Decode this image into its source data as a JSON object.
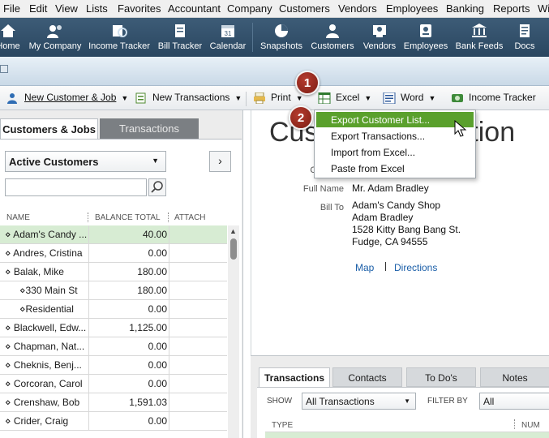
{
  "menubar": {
    "items": [
      "File",
      "Edit",
      "View",
      "Lists",
      "Favorites",
      "Accountant",
      "Company",
      "Customers",
      "Vendors",
      "Employees",
      "Banking",
      "Reports",
      "Wi"
    ]
  },
  "iconbar": {
    "items": [
      {
        "label": "Home",
        "icon": "home-icon"
      },
      {
        "label": "My Company",
        "icon": "my-company-icon"
      },
      {
        "label": "Income Tracker",
        "icon": "income-tracker-icon"
      },
      {
        "label": "Bill Tracker",
        "icon": "bill-tracker-icon"
      },
      {
        "label": "Calendar",
        "icon": "calendar-icon"
      },
      {
        "label": "Snapshots",
        "icon": "snapshots-icon"
      },
      {
        "label": "Customers",
        "icon": "customers-icon"
      },
      {
        "label": "Vendors",
        "icon": "vendors-icon"
      },
      {
        "label": "Employees",
        "icon": "employees-icon"
      },
      {
        "label": "Bank Feeds",
        "icon": "bank-feeds-icon"
      },
      {
        "label": "Docs",
        "icon": "docs-icon"
      }
    ],
    "calendar_day": "31"
  },
  "toolbar": {
    "new_customer_job": "New Customer & Job",
    "new_transactions": "New Transactions",
    "print": "Print",
    "excel": "Excel",
    "word": "Word",
    "income_tracker": "Income Tracker"
  },
  "left_panel": {
    "tabs": [
      "Customers & Jobs",
      "Transactions"
    ],
    "view_select": "Active Customers",
    "search_value": "",
    "columns": [
      "NAME",
      "BALANCE TOTAL",
      "ATTACH"
    ],
    "rows": [
      {
        "name": "⋄ Adam's Candy ...",
        "balance": "40.00",
        "selected": true,
        "sub": false
      },
      {
        "name": "⋄ Andres, Cristina",
        "balance": "0.00",
        "selected": false,
        "sub": false
      },
      {
        "name": "⋄ Balak, Mike",
        "balance": "180.00",
        "selected": false,
        "sub": false
      },
      {
        "name": "⋄330 Main St",
        "balance": "180.00",
        "selected": false,
        "sub": true
      },
      {
        "name": "⋄Residential",
        "balance": "0.00",
        "selected": false,
        "sub": true
      },
      {
        "name": "⋄ Blackwell, Edw...",
        "balance": "1,125.00",
        "selected": false,
        "sub": false
      },
      {
        "name": "⋄ Chapman, Nat...",
        "balance": "0.00",
        "selected": false,
        "sub": false
      },
      {
        "name": "⋄ Cheknis, Benj...",
        "balance": "0.00",
        "selected": false,
        "sub": false
      },
      {
        "name": "⋄ Corcoran, Carol",
        "balance": "0.00",
        "selected": false,
        "sub": false
      },
      {
        "name": "⋄ Crenshaw, Bob",
        "balance": "1,591.03",
        "selected": false,
        "sub": false
      },
      {
        "name": "⋄ Crider, Craig",
        "balance": "0.00",
        "selected": false,
        "sub": false
      }
    ]
  },
  "info": {
    "title_start": "Cus",
    "title_end": "nation",
    "company_label": "Compan",
    "fullname_label": "Full Name",
    "fullname_value": "Mr. Adam  Bradley",
    "billto_label": "Bill To",
    "billto_lines": [
      "Adam's Candy Shop",
      "Adam Bradley",
      "1528 Kitty Bang Bang St.",
      "Fudge, CA 94555"
    ],
    "map_link": "Map",
    "directions_link": "Directions"
  },
  "bottom_tabs": {
    "tabs": [
      "Transactions",
      "Contacts",
      "To Do's",
      "Notes"
    ],
    "show_label": "SHOW",
    "show_value": "All Transactions",
    "filter_label": "FILTER BY",
    "filter_value": "All",
    "col_type": "TYPE",
    "col_num": "NUM"
  },
  "excel_menu": {
    "items": [
      "Export Customer List...",
      "Export Transactions...",
      "Import from Excel...",
      "Paste from Excel"
    ],
    "highlighted_index": 0
  },
  "callouts": [
    "1",
    "2"
  ],
  "colors": {
    "highlight_green": "#5aa02c",
    "selected_row": "#d7ecd3",
    "iconbar_bg": "#2f4b64",
    "callout_red": "#9c2a1e",
    "link_blue": "#1a5ea8"
  }
}
